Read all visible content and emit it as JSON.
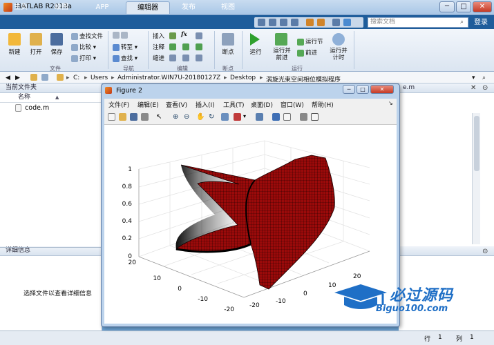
{
  "window": {
    "title": "MATLAB R2018a",
    "minimize": "─",
    "maximize": "□",
    "close": "✕"
  },
  "tabs": [
    "主页",
    "绘图",
    "APP",
    "编辑器",
    "发布",
    "视图"
  ],
  "active_tab": "编辑器",
  "search": {
    "placeholder": "搜索文档"
  },
  "login_label": "登录",
  "ribbon": {
    "file": {
      "new": "新建",
      "open": "打开",
      "save": "保存",
      "find_files": "查找文件",
      "compare": "比较",
      "print": "打印",
      "group": "文件"
    },
    "navigate": {
      "goto": "转至",
      "find": "查找",
      "group": "导航"
    },
    "edit": {
      "insert": "插入",
      "comment": "注释",
      "indent": "缩进",
      "fx": "fx",
      "group": "编辑"
    },
    "breakpoints": {
      "breakpoints": "断点",
      "group": "断点"
    },
    "run": {
      "run": "运行",
      "run_advance": "运行并\n前进",
      "run_section": "运行节",
      "advance": "前进",
      "run_time": "运行并\n计时",
      "group": "运行"
    }
  },
  "address": {
    "drive": "C:",
    "parts": [
      "Users",
      "Administrator.WIN7U-20180127Z",
      "Desktop",
      "涡旋光束空间相位模拟程序"
    ]
  },
  "current_folder": {
    "title": "当前文件夹",
    "column": "名称",
    "sort": "▲",
    "files": [
      "code.m"
    ]
  },
  "details": {
    "title": "详细信息",
    "message": "选择文件以查看详细信息"
  },
  "right_tab_label": "e.m",
  "figure": {
    "title": "Figure 2",
    "menus": [
      "文件(F)",
      "编辑(E)",
      "查看(V)",
      "插入(I)",
      "工具(T)",
      "桌面(D)",
      "窗口(W)",
      "帮助(H)"
    ]
  },
  "status": {
    "row_label": "行",
    "row": "1",
    "col_label": "列",
    "col": "1"
  },
  "watermark": {
    "name": "必过源码",
    "url": "Biguo100.com"
  },
  "colors": {
    "surface": "#9b0a0a",
    "tab_bar": "#1f5d9b",
    "accent": "#e8f0fa"
  },
  "chart_data": {
    "type": "surface3d",
    "title": "",
    "zticks": [
      "0",
      "0.2",
      "0.4",
      "0.6",
      "0.8",
      "1"
    ],
    "xticks": [
      "-20",
      "-10",
      "0",
      "10",
      "20"
    ],
    "yticks": [
      "-20",
      "-10",
      "0",
      "10",
      "20"
    ],
    "zlim": [
      0,
      1
    ],
    "grid": true
  }
}
